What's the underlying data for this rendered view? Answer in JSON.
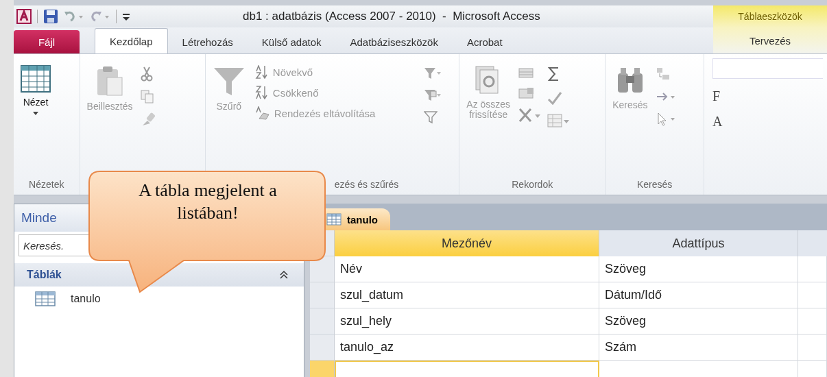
{
  "window": {
    "title": "db1 : adatbázis (Access 2007 - 2010)  -  Microsoft Access",
    "context_title": "Táblaeszközök"
  },
  "ribbon_tabs": [
    {
      "label": "Fájl",
      "kind": "file",
      "selected": false
    },
    {
      "label": "Kezdőlap",
      "kind": "tab",
      "selected": true
    },
    {
      "label": "Létrehozás",
      "kind": "tab",
      "selected": false
    },
    {
      "label": "Külső adatok",
      "kind": "tab",
      "selected": false
    },
    {
      "label": "Adatbáziseszközök",
      "kind": "tab",
      "selected": false
    },
    {
      "label": "Acrobat",
      "kind": "tab",
      "selected": false
    },
    {
      "label": "Tervezés",
      "kind": "context",
      "selected": false
    }
  ],
  "ribbon": {
    "views": {
      "button": "Nézet",
      "disabled": false,
      "group": "Nézetek"
    },
    "clipboard": {
      "button": "Beillesztés",
      "disabled": true
    },
    "sort": {
      "button": "Szűrő",
      "disabled": true,
      "items": [
        {
          "label": "Növekvő",
          "kind": "asc",
          "disabled": true
        },
        {
          "label": "Csökkenő",
          "kind": "desc",
          "disabled": true
        },
        {
          "label": "Rendezés eltávolítása",
          "kind": "clear",
          "disabled": true
        }
      ],
      "group": "ezés és szűrés"
    },
    "records": {
      "button_line_1": "Az összes",
      "button_line_2": "frissítése",
      "disabled": true,
      "group": "Rekordok"
    },
    "find": {
      "button": "Keresés",
      "disabled": true,
      "group": "Keresés"
    },
    "font_partial": [
      "F",
      "A"
    ]
  },
  "nav_pane": {
    "header": "Minde",
    "search_placeholder": "Keresés.",
    "groups": [
      {
        "label": "Táblák",
        "expanded": true,
        "items": [
          {
            "label": "tanulo",
            "selected": false
          }
        ]
      }
    ]
  },
  "document_tab": {
    "label": "tanulo",
    "selected": true
  },
  "design_grid": {
    "columns": [
      {
        "label": "Mezőnév",
        "selected": true
      },
      {
        "label": "Adattípus",
        "selected": false
      }
    ],
    "rows": [
      {
        "field": "Név",
        "type": "Szöveg",
        "selected": false
      },
      {
        "field": "szul_datum",
        "type": "Dátum/Idő",
        "selected": false
      },
      {
        "field": "szul_hely",
        "type": "Szöveg",
        "selected": false
      },
      {
        "field": "tanulo_az",
        "type": "Szám",
        "selected": false
      }
    ],
    "new_row": {
      "selected": true
    }
  },
  "callout": {
    "text": "A tábla megjelent a listában!"
  }
}
